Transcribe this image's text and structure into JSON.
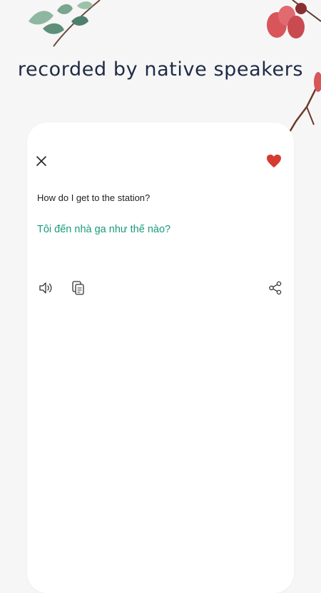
{
  "header": {
    "title": "recorded by native speakers"
  },
  "card": {
    "source_text": "How do I get to the station?",
    "translation_text": "Tôi đến nhà ga như thế nào?",
    "favorite": true
  },
  "icons": {
    "close": "close-icon",
    "favorite": "heart-icon",
    "speaker": "speaker-icon",
    "copy": "copy-icon",
    "share": "share-icon"
  },
  "colors": {
    "translation": "#1a9a7c",
    "heart": "#d63b30",
    "title": "#1f2a44"
  }
}
